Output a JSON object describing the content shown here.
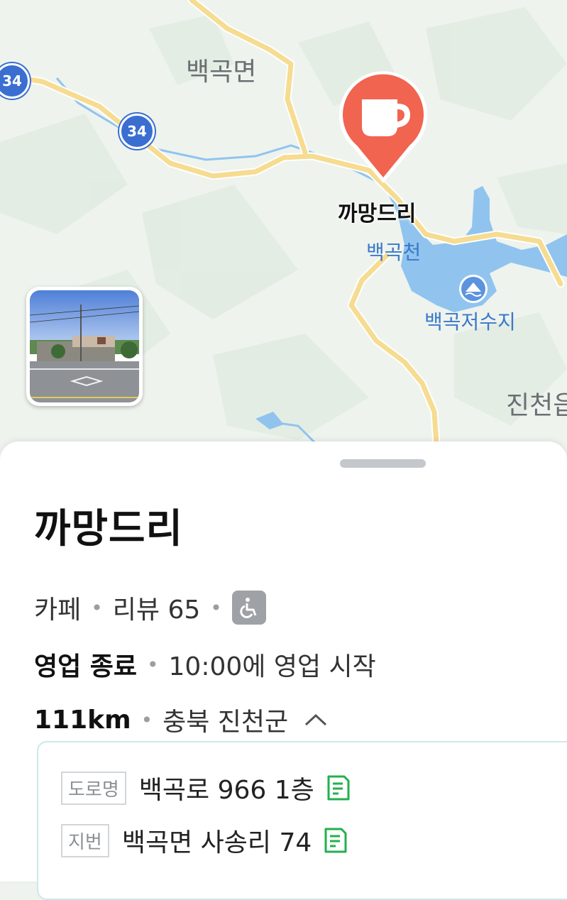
{
  "map": {
    "town_label": "백곡면",
    "stream_label": "백곡천",
    "reservoir_label": "백곡저수지",
    "edge_label": "진천읍",
    "route_number": "34",
    "pin_label": "까망드리",
    "pin_icon": "coffee-cup-icon",
    "pin_color": "#f06450",
    "road_color": "#f6dc91",
    "water_color": "#90c4ef"
  },
  "place": {
    "name": "까망드리",
    "category": "카페",
    "reviews": "리뷰 65",
    "accessibility_icon": "wheelchair-icon",
    "status": "영업 종료",
    "next_open": "10:00에 영업 시작",
    "distance": "111km",
    "region": "충북 진천군",
    "address": {
      "road_tag": "도로명",
      "road_address": "백곡로 966 1층",
      "lot_tag": "지번",
      "lot_address": "백곡면 사송리 74"
    }
  }
}
